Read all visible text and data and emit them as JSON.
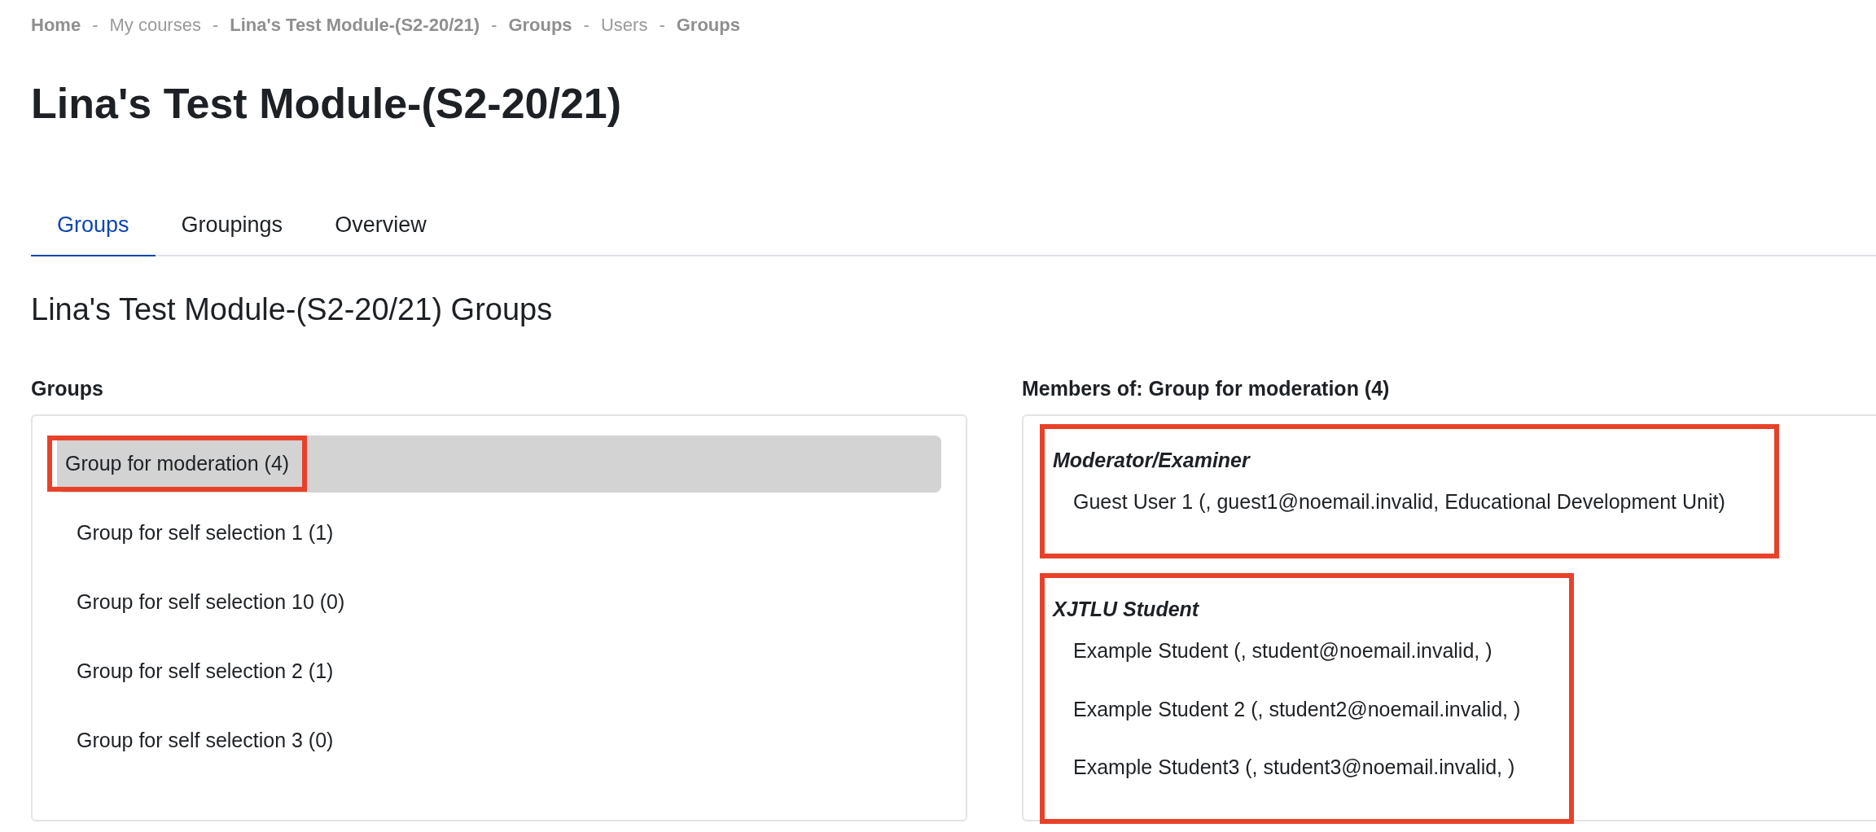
{
  "breadcrumb": [
    {
      "label": "Home",
      "bold": true
    },
    {
      "label": "My courses",
      "bold": false
    },
    {
      "label": "Lina's Test Module-(S2-20/21)",
      "bold": true
    },
    {
      "label": "Groups",
      "bold": true
    },
    {
      "label": "Users",
      "bold": false
    },
    {
      "label": "Groups",
      "bold": true
    }
  ],
  "breadcrumb_separator": "-",
  "title": "Lina's Test Module-(S2-20/21)",
  "tabs": [
    {
      "label": "Groups",
      "selected": true
    },
    {
      "label": "Groupings",
      "selected": false
    },
    {
      "label": "Overview",
      "selected": false
    }
  ],
  "heading": "Lina's Test Module-(S2-20/21) Groups",
  "groups_panel": {
    "label": "Groups",
    "items": [
      {
        "label": "Group for moderation (4)",
        "selected": true,
        "highlighted": true
      },
      {
        "label": "Group for self selection 1 (1)",
        "selected": false,
        "highlighted": false
      },
      {
        "label": "Group for self selection 10 (0)",
        "selected": false,
        "highlighted": false
      },
      {
        "label": "Group for self selection 2 (1)",
        "selected": false,
        "highlighted": false
      },
      {
        "label": "Group for self selection 3 (0)",
        "selected": false,
        "highlighted": false
      }
    ]
  },
  "members_panel": {
    "label": "Members of: Group for moderation (4)",
    "sections": [
      {
        "role": "Moderator/Examiner",
        "highlighted": true,
        "members": [
          "Guest User 1 (, guest1@noemail.invalid, Educational Development Unit)"
        ]
      },
      {
        "role": "XJTLU Student",
        "highlighted": true,
        "members": [
          "Example Student (, student@noemail.invalid, )",
          "Example Student 2 (, student2@noemail.invalid, )",
          "Example Student3 (, student3@noemail.invalid, )"
        ]
      }
    ]
  }
}
